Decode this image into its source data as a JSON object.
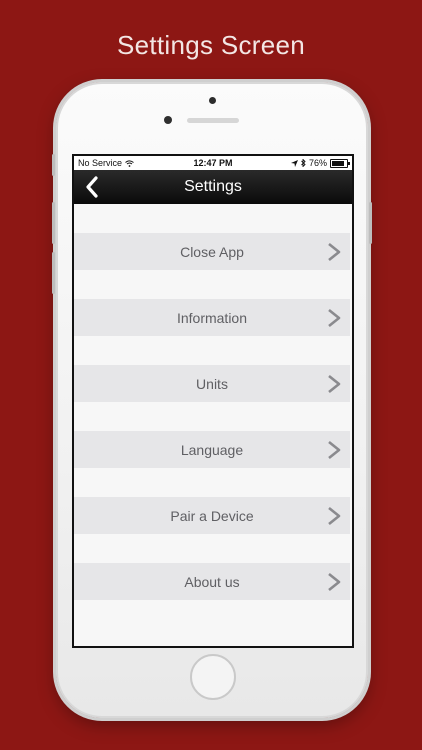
{
  "headline": "Settings Screen",
  "statusbar": {
    "carrier": "No Service",
    "time": "12:47 PM",
    "battery": "76%",
    "battery_level": 0.76
  },
  "navbar": {
    "title": "Settings"
  },
  "menu": {
    "items": [
      {
        "label": "Close App"
      },
      {
        "label": "Information"
      },
      {
        "label": "Units"
      },
      {
        "label": "Language"
      },
      {
        "label": "Pair a Device"
      },
      {
        "label": "About us"
      }
    ]
  },
  "colors": {
    "background": "#8d1714",
    "navbar": "#0a0a0a",
    "row": "#e6e6e8",
    "chevron": "#8a8a8e"
  }
}
